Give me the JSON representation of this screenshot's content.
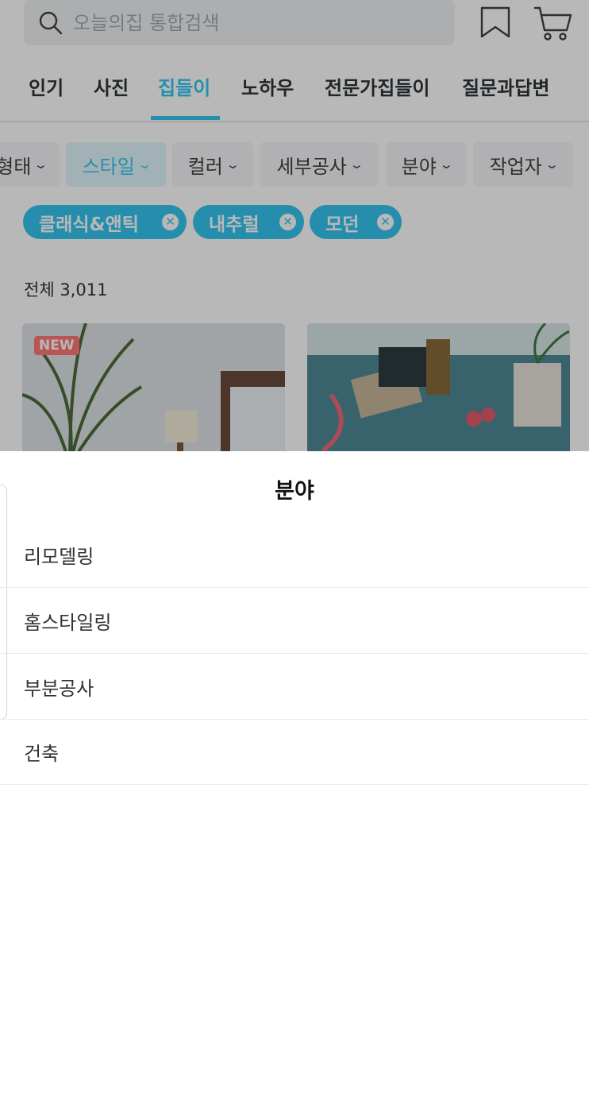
{
  "search": {
    "placeholder": "오늘의집 통합검색"
  },
  "tabs": [
    {
      "label": "인기"
    },
    {
      "label": "사진"
    },
    {
      "label": "집들이"
    },
    {
      "label": "노하우"
    },
    {
      "label": "전문가집들이"
    },
    {
      "label": "질문과답변"
    }
  ],
  "active_tab": "집들이",
  "filters": [
    {
      "label": "형태"
    },
    {
      "label": "스타일"
    },
    {
      "label": "컬러"
    },
    {
      "label": "세부공사"
    },
    {
      "label": "분야"
    },
    {
      "label": "작업자"
    }
  ],
  "active_filter": "스타일",
  "tags": [
    {
      "label": "클래식&앤틱"
    },
    {
      "label": "내추럴"
    },
    {
      "label": "모던"
    }
  ],
  "total_count": "전체 3,011",
  "cards": [
    {
      "badge": "NEW"
    },
    {
      "badge": ""
    }
  ],
  "sheet": {
    "title": "분야",
    "options": [
      {
        "label": "리모델링"
      },
      {
        "label": "홈스타일링"
      },
      {
        "label": "부분공사"
      },
      {
        "label": "건축"
      }
    ]
  },
  "colors": {
    "accent": "#35c5f0",
    "text": "#2f3438",
    "badge": "#ff7777"
  }
}
